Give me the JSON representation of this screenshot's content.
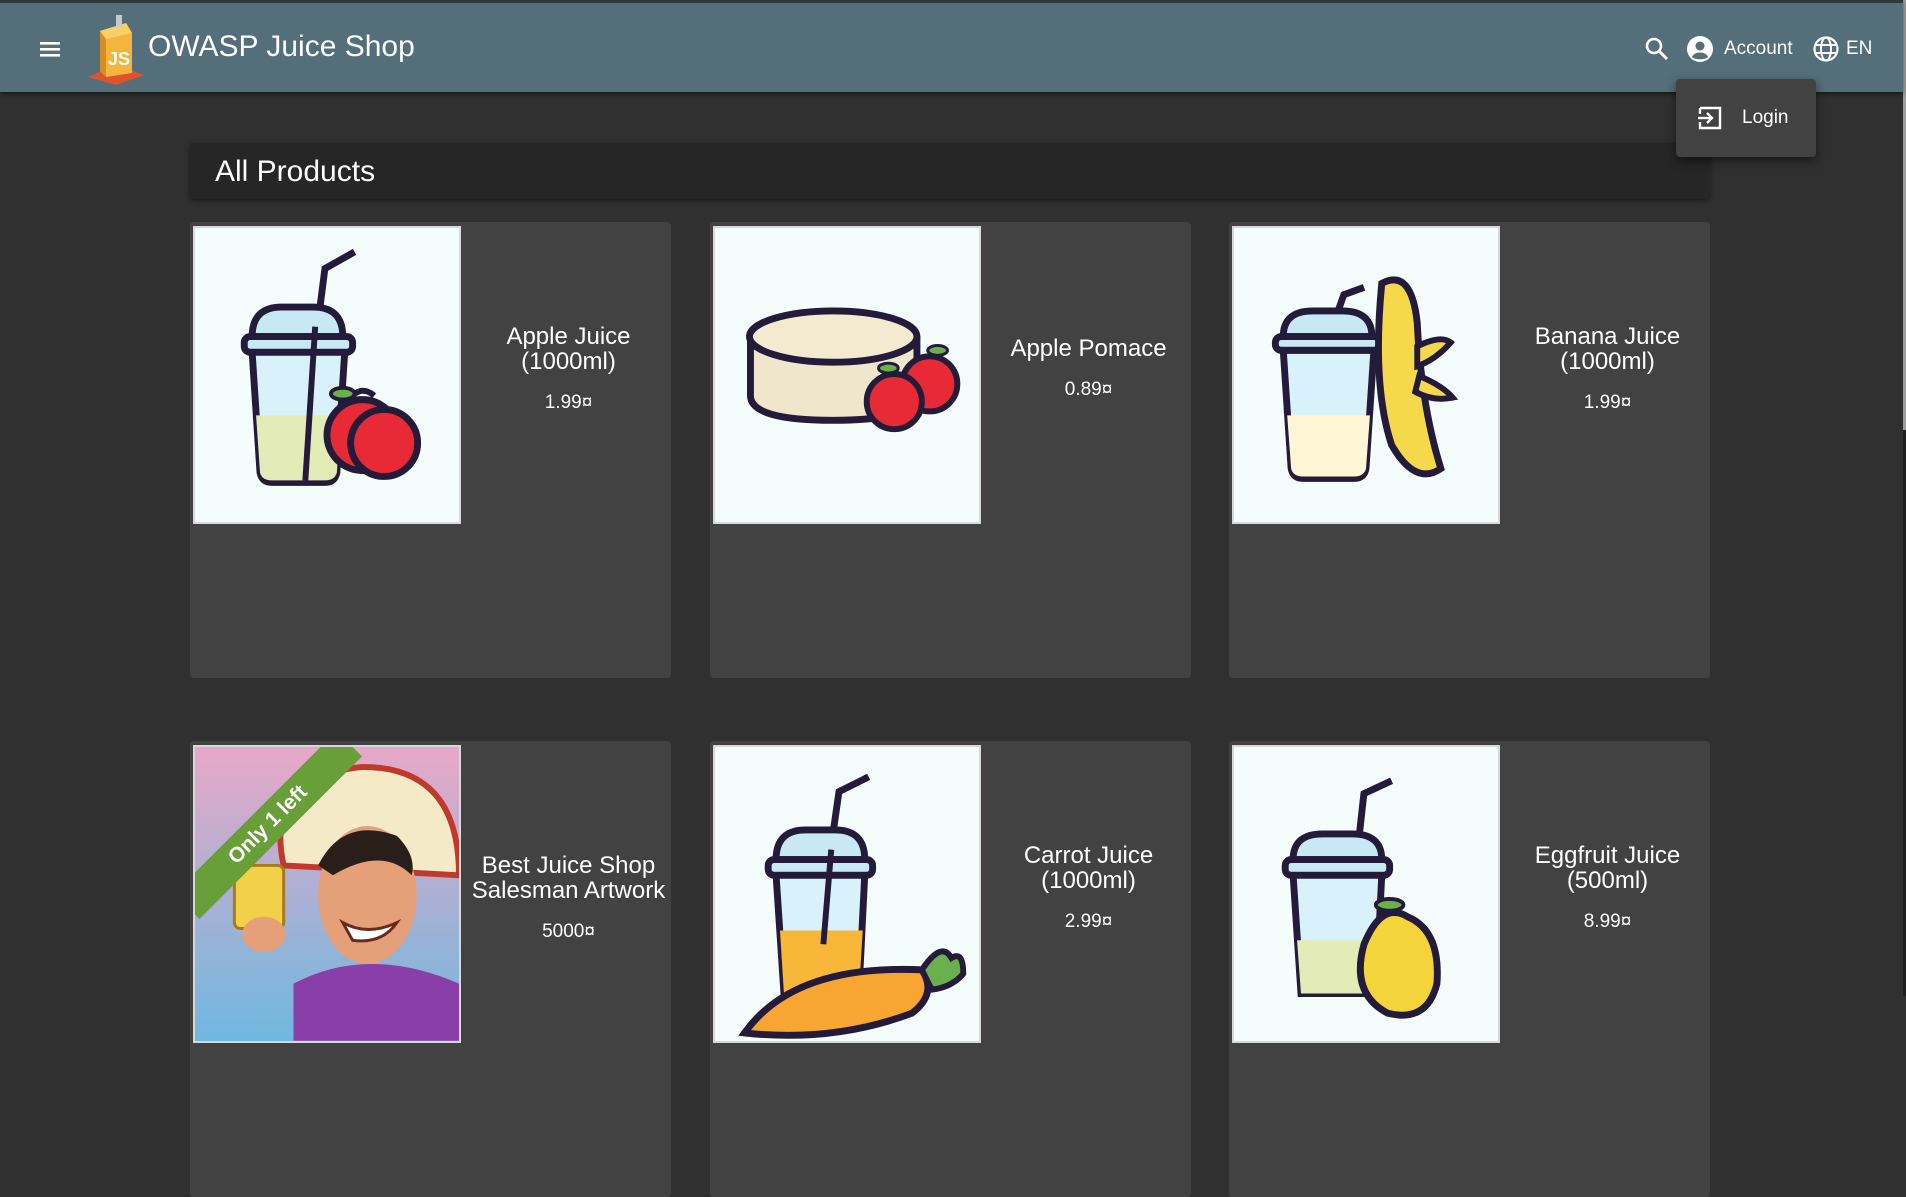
{
  "toolbar": {
    "title": "OWASP Juice Shop",
    "menu_icon": "menu-icon",
    "search_icon": "search-icon",
    "account_label": "Account",
    "account_icon": "account-circle-icon",
    "language_label": "EN",
    "language_icon": "globe-icon"
  },
  "account_menu": {
    "login_label": "Login",
    "login_icon": "login-icon"
  },
  "page": {
    "heading": "All Products"
  },
  "products": [
    {
      "name": "Apple Juice (1000ml)",
      "price": "1.99¤",
      "image": "apple-juice-image"
    },
    {
      "name": "Apple Pomace",
      "price": "0.89¤",
      "image": "apple-pomace-image"
    },
    {
      "name": "Banana Juice (1000ml)",
      "price": "1.99¤",
      "image": "banana-juice-image"
    },
    {
      "name": "Best Juice Shop Salesman Artwork",
      "price": "5000¤",
      "image": "salesman-artwork-image",
      "badge": "Only 1 left"
    },
    {
      "name": "Carrot Juice (1000ml)",
      "price": "2.99¤",
      "image": "carrot-juice-image"
    },
    {
      "name": "Eggfruit Juice (500ml)",
      "price": "8.99¤",
      "image": "eggfruit-juice-image"
    }
  ],
  "colors": {
    "toolbar": "#546e7a",
    "background": "#303030",
    "card": "#424242",
    "badge": "#689f38"
  }
}
